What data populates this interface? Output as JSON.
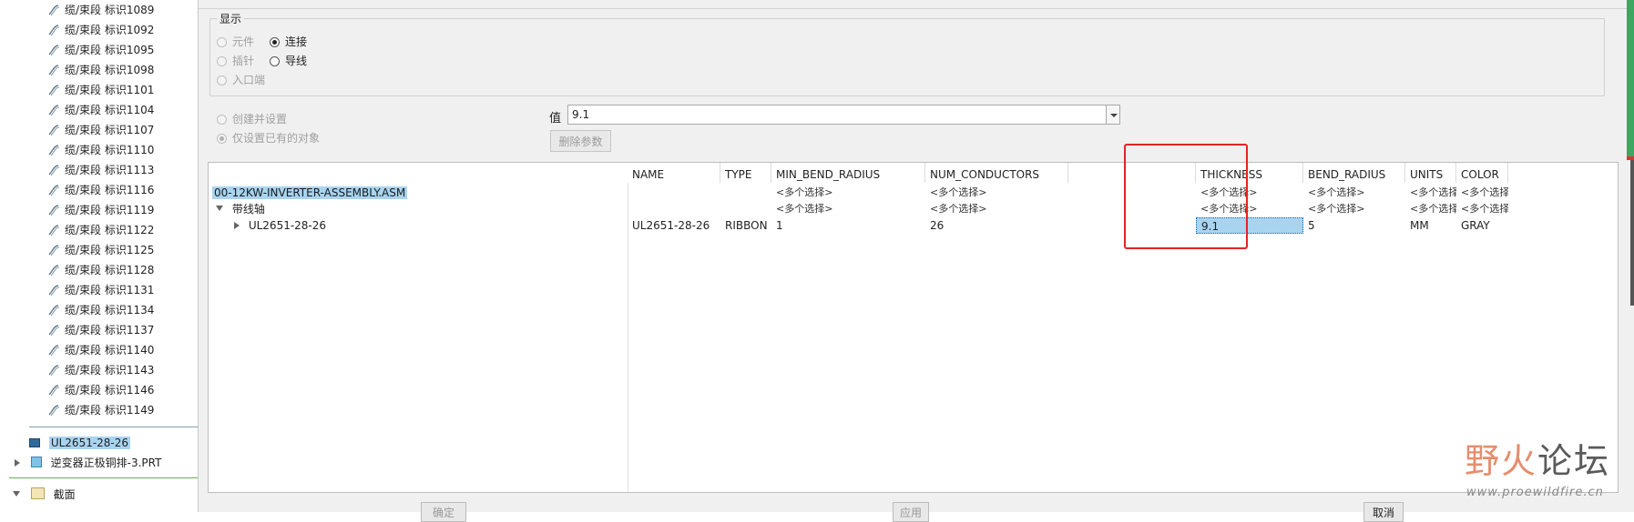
{
  "left_tree": {
    "cable_items": [
      "缆/束段 标识1089",
      "缆/束段 标识1092",
      "缆/束段 标识1095",
      "缆/束段 标识1098",
      "缆/束段 标识1101",
      "缆/束段 标识1104",
      "缆/束段 标识1107",
      "缆/束段 标识1110",
      "缆/束段 标识1113",
      "缆/束段 标识1116",
      "缆/束段 标识1119",
      "缆/束段 标识1122",
      "缆/束段 标识1125",
      "缆/束段 标识1128",
      "缆/束段 标识1131",
      "缆/束段 标识1134",
      "缆/束段 标识1137",
      "缆/束段 标识1140",
      "缆/束段 标识1143",
      "缆/束段 标识1146",
      "缆/束段 标识1149"
    ],
    "selected_node": "UL2651-28-26",
    "part_node": "逆变器正极铜排-3.PRT",
    "section_node": "截面"
  },
  "display_group": {
    "title": "显示",
    "options": {
      "component": "元件",
      "connection": "连接",
      "pin": "插针",
      "wire": "导线",
      "entry_port": "入口端"
    },
    "selected": "connection"
  },
  "mode": {
    "create_and_set": "创建并设置",
    "set_existing_only": "仅设置已有的对象",
    "selected": "set_existing_only"
  },
  "value": {
    "label": "值",
    "current": "9.1"
  },
  "delete_param_label": "删除参数",
  "table": {
    "columns": [
      "NAME",
      "TYPE",
      "MIN_BEND_RADIUS",
      "NUM_CONDUCTORS",
      "THICKNESS",
      "BEND_RADIUS",
      "UNITS",
      "COLOR"
    ],
    "multi_select_text": "<多个选择>",
    "asm_name": "00-12KW-INVERTER-ASSEMBLY.ASM",
    "spool_group": "带线轴",
    "spool_row": {
      "label": "UL2651-28-26",
      "name": "UL2651-28-26",
      "type": "RIBBON",
      "min_bend_radius": "1",
      "num_conductors": "26",
      "thickness": "9.1",
      "bend_radius": "5",
      "units": "MM",
      "color": "GRAY"
    }
  },
  "buttons": {
    "ok": "确定",
    "apply": "应用",
    "cancel": "取消"
  },
  "watermark": {
    "title_a": "野火",
    "title_b": "论坛",
    "url": "www.proewildfire.cn"
  },
  "colors": {
    "selection": "#a9d4f0",
    "highlight_box": "#e32424",
    "watermark": "#e48e6e"
  }
}
